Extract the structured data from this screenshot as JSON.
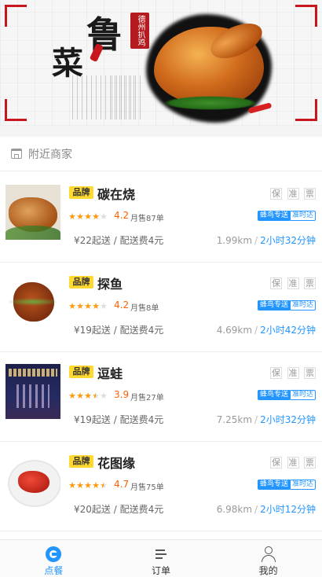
{
  "banner": {
    "title_chars": [
      "鲁",
      "菜"
    ],
    "seal_text": "德州扒鸡"
  },
  "section": {
    "label": "附近商家",
    "icon": "shop-icon"
  },
  "shops": [
    {
      "brand_badge": "品牌",
      "name": "碳在烧",
      "guarantees": [
        "保",
        "准",
        "票"
      ],
      "rating_stars": 4.2,
      "rating": "4.2",
      "monthly_sales": "月售87单",
      "tag_delivery": "蜂鸟专送",
      "tag_ontime": "准时达",
      "min_order": "¥22起送",
      "fee_sep": " / ",
      "delivery_fee": "配送费4元",
      "distance": "1.99km",
      "time_sep": "/",
      "time": "2小时32分钟"
    },
    {
      "brand_badge": "品牌",
      "name": "探鱼",
      "guarantees": [
        "保",
        "准",
        "票"
      ],
      "rating_stars": 4.2,
      "rating": "4.2",
      "monthly_sales": "月售8单",
      "tag_delivery": "蜂鸟专送",
      "tag_ontime": "准时达",
      "min_order": "¥19起送",
      "fee_sep": " / ",
      "delivery_fee": "配送费4元",
      "distance": "4.69km",
      "time_sep": "/",
      "time": "2小时42分钟"
    },
    {
      "brand_badge": "品牌",
      "name": "逗蛙",
      "guarantees": [
        "保",
        "准",
        "票"
      ],
      "rating_stars": 3.9,
      "rating": "3.9",
      "monthly_sales": "月售27单",
      "tag_delivery": "蜂鸟专送",
      "tag_ontime": "准时达",
      "min_order": "¥19起送",
      "fee_sep": " / ",
      "delivery_fee": "配送费4元",
      "distance": "7.25km",
      "time_sep": "/",
      "time": "2小时32分钟"
    },
    {
      "brand_badge": "品牌",
      "name": "花图缘",
      "guarantees": [
        "保",
        "准",
        "票"
      ],
      "rating_stars": 4.7,
      "rating": "4.7",
      "monthly_sales": "月售75单",
      "tag_delivery": "蜂鸟专送",
      "tag_ontime": "准时达",
      "min_order": "¥20起送",
      "fee_sep": " / ",
      "delivery_fee": "配送费4元",
      "distance": "6.98km",
      "time_sep": "/",
      "time": "2小时12分钟"
    }
  ],
  "tabbar": {
    "items": [
      {
        "label": "点餐",
        "icon": "eleme-logo-icon",
        "active": true
      },
      {
        "label": "订单",
        "icon": "order-list-icon",
        "active": false
      },
      {
        "label": "我的",
        "icon": "user-profile-icon",
        "active": false
      }
    ]
  },
  "colors": {
    "accent": "#2395ff",
    "rating": "#ff6000",
    "star": "#ff9a0d",
    "brand_badge_bg": "#ffd930",
    "banner_red": "#c8161d"
  }
}
